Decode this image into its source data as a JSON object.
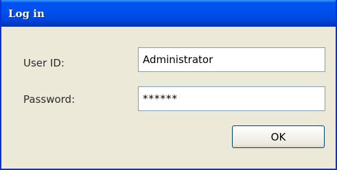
{
  "window": {
    "title": "Log in"
  },
  "form": {
    "user_id_label": "User ID:",
    "user_id_value": "Administrator",
    "password_label": "Password:",
    "password_value": "******",
    "ok_label": "OK"
  },
  "colors": {
    "titlebar": "#0054e3",
    "window_bg": "#ece9d8",
    "border": "#0831d9",
    "field_border": "#7f9db9"
  }
}
